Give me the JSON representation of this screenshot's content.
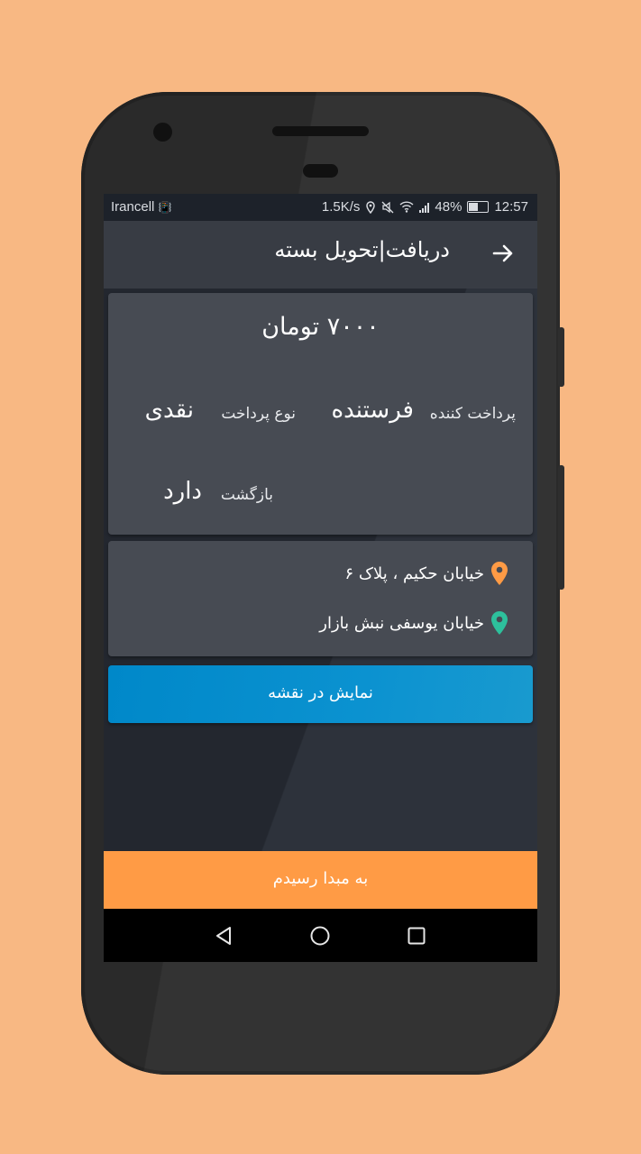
{
  "colors": {
    "page_background": "#F8B883",
    "app_background": "#23272F",
    "appbar": "#383C44",
    "card": "#474B53",
    "primary_blue": "#0B92D0",
    "accent_orange": "#FF9B45",
    "pin_orange": "#FF9B45",
    "pin_green": "#2DC09C"
  },
  "statusbar": {
    "carrier": "Irancell",
    "speed": "1.5K/s",
    "battery": "48%",
    "time": "12:57",
    "icons": [
      "vibrate-icon",
      "location-icon",
      "mute-icon",
      "wifi-icon",
      "signal-icon",
      "battery-icon"
    ]
  },
  "appbar": {
    "title": "دریافت|تحویل بسته",
    "back_icon": "arrow-right-icon"
  },
  "details": {
    "price": "۷۰۰۰ تومان",
    "payer_label": "پرداخت کننده",
    "payer_value": "فرستنده",
    "payment_type_label": "نوع پرداخت",
    "payment_type_value": "نقدی",
    "return_label": "بازگشت",
    "return_value": "دارد"
  },
  "addresses": {
    "origin": "خیابان حکیم ، پلاک ۶",
    "origin_icon": "map-pin-orange-icon",
    "destination": "خیابان یوسفی نبش بازار",
    "destination_icon": "map-pin-green-icon"
  },
  "buttons": {
    "show_map": "نمایش در نقشه",
    "arrived_origin": "به مبدا رسیدم"
  },
  "navbar": {
    "icons": [
      "back-triangle-icon",
      "home-circle-icon",
      "recents-square-icon"
    ]
  }
}
